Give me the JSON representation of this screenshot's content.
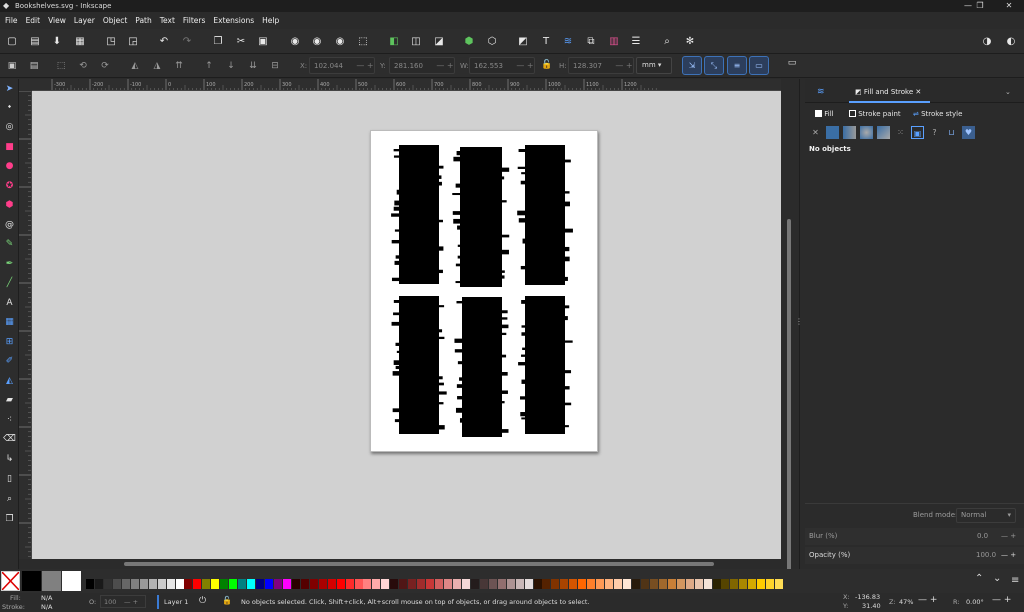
{
  "window": {
    "title": "Bookshelves.svg - Inkscape",
    "minimize": "—",
    "maximize": "❐",
    "close": "✕"
  },
  "menu": [
    "File",
    "Edit",
    "View",
    "Layer",
    "Object",
    "Path",
    "Text",
    "Filters",
    "Extensions",
    "Help"
  ],
  "select_toolbar": {
    "x": {
      "label": "X:",
      "value": "102.044"
    },
    "y": {
      "label": "Y:",
      "value": "281.160"
    },
    "w": {
      "label": "W:",
      "value": "162.553"
    },
    "h": {
      "label": "H:",
      "value": "128.307"
    },
    "unit": "mm"
  },
  "ruler": {
    "h_ticks": [
      "-300",
      "-200",
      "-100",
      "0",
      "100",
      "200",
      "300",
      "400",
      "500",
      "600",
      "700",
      "800",
      "900",
      "1000",
      "1100",
      "1200"
    ],
    "v_ticks": [
      "-100",
      "0",
      "100",
      "200",
      "300",
      "400",
      "500",
      "600",
      "700",
      "800"
    ]
  },
  "dock": {
    "tab_label": "Fill and Stroke",
    "fill_tab": "Fill",
    "stroke_paint_tab": "Stroke paint",
    "stroke_style_tab": "Stroke style",
    "no_objects": "No objects",
    "blend_label": "Blend mode:",
    "blend_value": "Normal",
    "blur_label": "Blur (%)",
    "blur_value": "0.0",
    "opacity_label": "Opacity (%)",
    "opacity_value": "100.0"
  },
  "status": {
    "fill_label": "Fill:",
    "fill_value": "N/A",
    "stroke_label": "Stroke:",
    "stroke_value": "N/A",
    "opacity_label": "O:",
    "opacity_value": "100",
    "layer": "Layer 1",
    "message": "No objects selected. Click, Shift+click, Alt+scroll mouse on top of objects, or drag around objects to select.",
    "x_label": "X:",
    "x_value": "-136.83",
    "y_label": "Y:",
    "y_value": "31.40",
    "zoom_label": "Z:",
    "zoom_value": "47%",
    "rot_label": "R:",
    "rot_value": "0.00°"
  },
  "palette": [
    "#000000",
    "#1a1a1a",
    "#333333",
    "#4d4d4d",
    "#666666",
    "#808080",
    "#999999",
    "#b3b3b3",
    "#cccccc",
    "#e6e6e6",
    "#ffffff",
    "#800000",
    "#ff0000",
    "#808000",
    "#ffff00",
    "#008000",
    "#00ff00",
    "#008080",
    "#00ffff",
    "#000080",
    "#0000ff",
    "#800080",
    "#ff00ff",
    "#2b0000",
    "#550000",
    "#800000",
    "#aa0000",
    "#d40000",
    "#ff0000",
    "#ff2a2a",
    "#ff5555",
    "#ff8080",
    "#ffaaaa",
    "#ffd5d5",
    "#280b0b",
    "#501616",
    "#782121",
    "#a02c2c",
    "#c83737",
    "#d35f5f",
    "#de8787",
    "#e9afaf",
    "#f4d7d7",
    "#241c1c",
    "#483737",
    "#6c5353",
    "#916f6f",
    "#ac9393",
    "#c8b7b7",
    "#e3dbdb",
    "#2b1100",
    "#552200",
    "#803300",
    "#aa4400",
    "#d45500",
    "#ff6600",
    "#ff7f2a",
    "#ff9955",
    "#ffb380",
    "#ffccaa",
    "#ffe6d5",
    "#281a0b",
    "#503416",
    "#784e21",
    "#a0682c",
    "#c87f37",
    "#d3965f",
    "#deaa87",
    "#e9c6af",
    "#f4e3d7",
    "#2b2200",
    "#554400",
    "#806600",
    "#aa8800",
    "#d4aa00",
    "#ffcc00",
    "#ffd42a",
    "#ffdd55"
  ]
}
